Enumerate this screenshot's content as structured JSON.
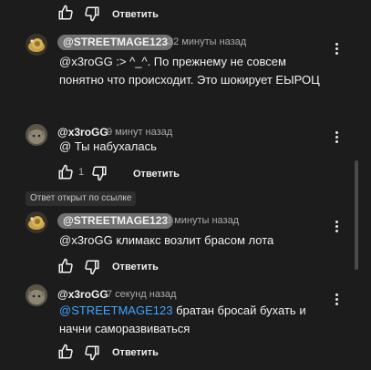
{
  "top_reply": {
    "reply_label": "Ответить"
  },
  "comments": [
    {
      "author": "@STREETMAGE123",
      "time": "32 минуты назад",
      "line1": "@x3roGG :> ^_^. По прежнему не совсем",
      "line2": "понятно что происходит. Это шокирует ЕЫРОЦ",
      "reply_label": "Ответить"
    },
    {
      "author": "@x3roGG",
      "time": "9 минут назад",
      "line1": "@ Ты набухалась",
      "likes": "1",
      "reply_label": "Ответить"
    },
    {
      "author": "@STREETMAGE123",
      "time": "3 минуты назад",
      "line1": "@x3roGG  климакс возлит брасом лота",
      "reply_label": "Ответить"
    },
    {
      "author": "@x3roGG",
      "time": "7 секунд назад",
      "mention": "@STREETMAGE123",
      "line1_rest": "  братан бросай бухать и",
      "line2": "начни саморазвиваться",
      "reply_label": "Ответить"
    }
  ],
  "banner": "Ответ открыт по ссылке",
  "colors": {
    "bg": "#1c1c1c",
    "chip": "#717171",
    "mention": "#3ea6ff",
    "muted": "#aaaaaa"
  },
  "icons": [
    "thumb-up-icon",
    "thumb-down-icon",
    "more-vert-icon",
    "avatar-cat",
    "avatar-snail"
  ]
}
